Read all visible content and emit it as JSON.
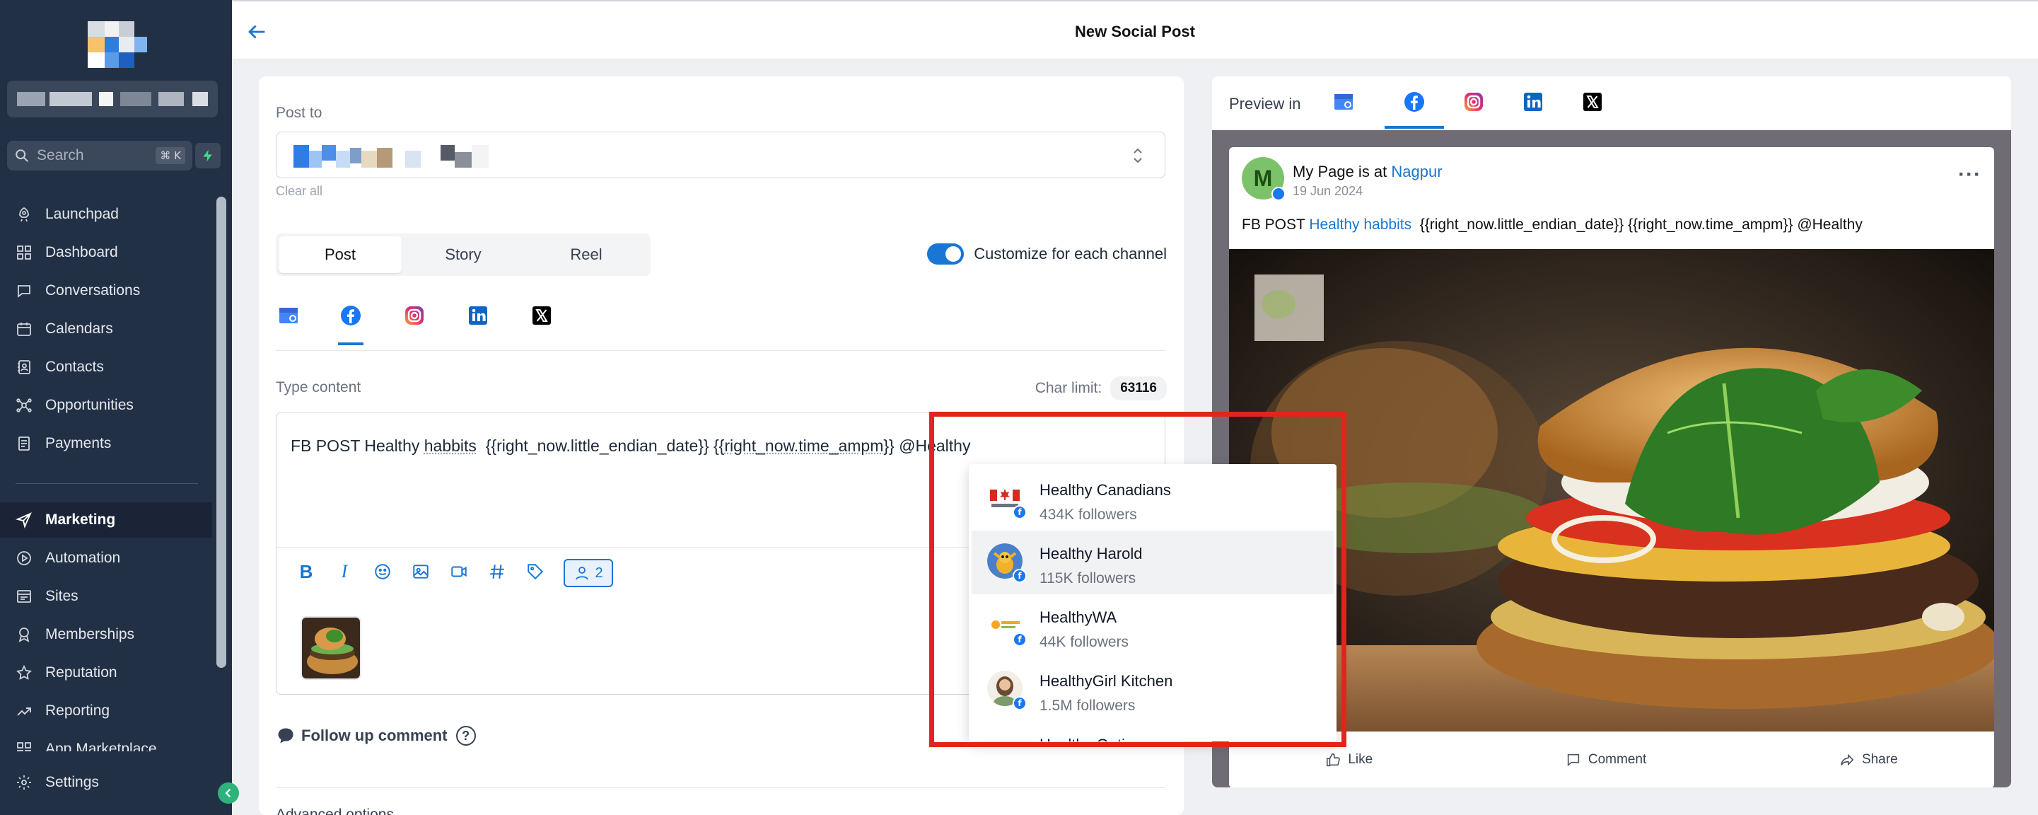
{
  "sidebar": {
    "search": {
      "placeholder": "Search",
      "shortcut": "⌘ K"
    },
    "items": [
      {
        "label": "Launchpad",
        "icon": "rocket-icon"
      },
      {
        "label": "Dashboard",
        "icon": "dashboard-icon"
      },
      {
        "label": "Conversations",
        "icon": "chat-icon"
      },
      {
        "label": "Calendars",
        "icon": "calendar-icon"
      },
      {
        "label": "Contacts",
        "icon": "contacts-icon"
      },
      {
        "label": "Opportunities",
        "icon": "opportunities-icon"
      },
      {
        "label": "Payments",
        "icon": "payments-icon"
      },
      {
        "label": "Marketing",
        "icon": "send-icon",
        "active": true
      },
      {
        "label": "Automation",
        "icon": "automation-icon"
      },
      {
        "label": "Sites",
        "icon": "sites-icon"
      },
      {
        "label": "Memberships",
        "icon": "memberships-icon"
      },
      {
        "label": "Reputation",
        "icon": "star-icon"
      },
      {
        "label": "Reporting",
        "icon": "trend-icon"
      },
      {
        "label": "App Marketplace",
        "icon": "grid-icon"
      }
    ],
    "settings_label": "Settings"
  },
  "header": {
    "title": "New Social Post"
  },
  "editor": {
    "post_to_label": "Post to",
    "clear_all": "Clear all",
    "post_types": [
      "Post",
      "Story",
      "Reel"
    ],
    "selected_post_type": "Post",
    "customize_label": "Customize for each channel",
    "customize_on": true,
    "channels": [
      "google-business-icon",
      "facebook-icon",
      "instagram-icon",
      "linkedin-icon",
      "x-icon"
    ],
    "selected_channel": "facebook-icon",
    "type_content_label": "Type content",
    "char_limit_label": "Char limit:",
    "char_limit_value": "63116",
    "content": {
      "prefix": "FB POST Healthy ",
      "underlined": "habbits",
      "middle": "  {{right_now.little_endian_date}} {{",
      "underlined2": "right_now.time_ampm",
      "suffix": "}} @Healthy"
    },
    "mention_count": "2",
    "follow_up_label": "Follow up comment",
    "help_glyph": "?",
    "advanced_label": "Advanced options"
  },
  "mention_dropdown": {
    "items": [
      {
        "name": "Healthy Canadians",
        "followers": "434K followers"
      },
      {
        "name": "Healthy Harold",
        "followers": "115K followers",
        "highlighted": true
      },
      {
        "name": "HealthyWA",
        "followers": "44K followers"
      },
      {
        "name": "HealthyGirl Kitchen",
        "followers": "1.5M followers"
      },
      {
        "name": "Healthy Options",
        "followers": ""
      }
    ],
    "facebook_badge": "f"
  },
  "preview": {
    "label": "Preview in",
    "selected_channel": "facebook-icon",
    "post": {
      "avatar_letter": "M",
      "page_name": "My Page is at ",
      "location": "Nagpur",
      "date": "19 Jun 2024",
      "text_prefix": "FB POST ",
      "text_link": "Healthy habbits",
      "text_suffix": "  {{right_now.little_endian_date}} {{right_now.time_ampm}} @Healthy",
      "actions": [
        "Like",
        "Comment",
        "Share"
      ]
    }
  },
  "colors": {
    "sidebar_bg": "#223046",
    "accent": "#1976d2",
    "highlight_frame": "#e4241c",
    "facebook": "#1877f2"
  }
}
